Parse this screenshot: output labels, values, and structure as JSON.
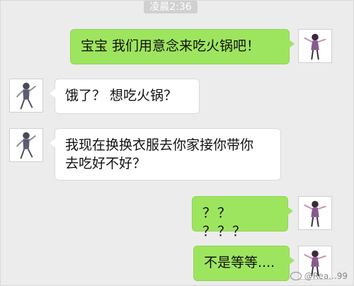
{
  "status": {
    "time": "凌晨2:36"
  },
  "messages": [
    {
      "side": "right",
      "text": "宝宝 我们用意念来吃火锅吧！"
    },
    {
      "side": "left",
      "text": "饿了？ 想吃火锅？"
    },
    {
      "side": "left",
      "text": "我现在换换衣服去你家接你带你\n去吃好不好？"
    },
    {
      "side": "right",
      "text": "？？ ？？？"
    },
    {
      "side": "right",
      "text": "不是等等...."
    }
  ],
  "watermark": {
    "text": "@Rea...99"
  },
  "colors": {
    "sent_bubble": "#9ee55f",
    "received_bubble": "#ffffff",
    "background": "#ececec"
  },
  "icons": {
    "avatar_self": "anime-girl-avatar",
    "avatar_other": "anime-boy-avatar"
  }
}
